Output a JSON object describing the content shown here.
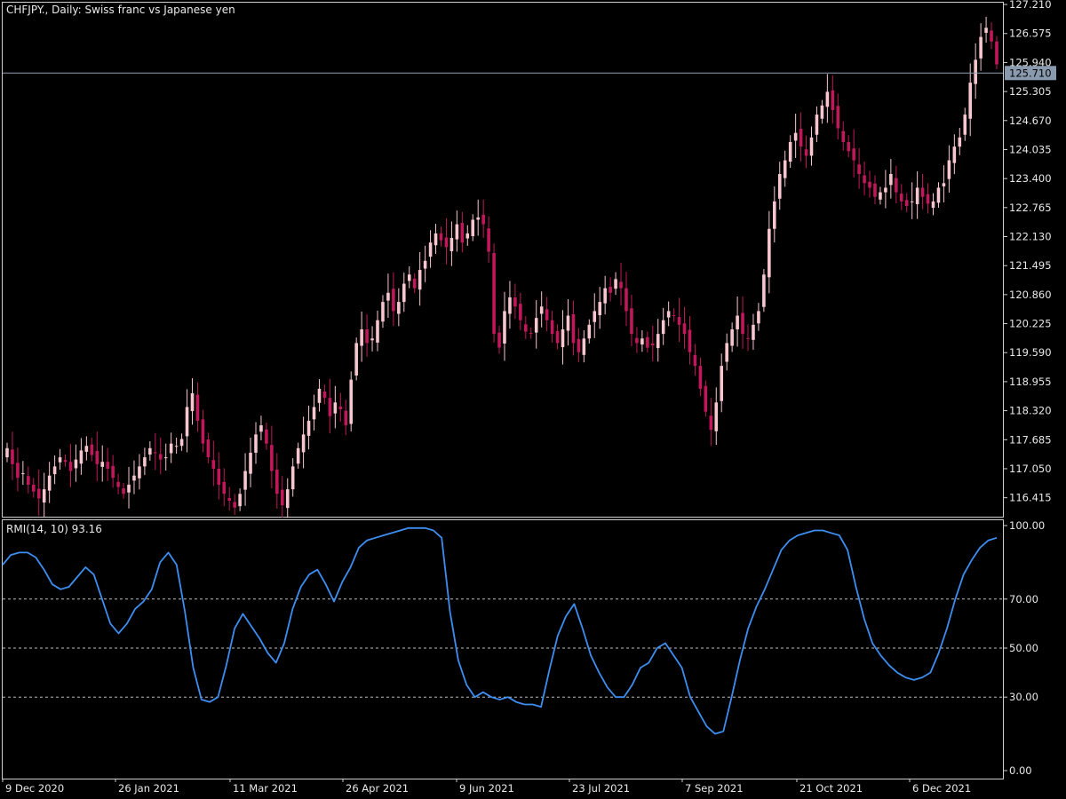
{
  "chart_data": [
    {
      "type": "candlestick",
      "title": "CHFJPY., Daily:  Swiss franc vs Japanese yen",
      "ylim": [
        116.0,
        127.25
      ],
      "y_ticks": [
        "127.210",
        "126.575",
        "125.940",
        "125.305",
        "124.670",
        "124.035",
        "123.400",
        "122.765",
        "122.130",
        "121.495",
        "120.860",
        "120.225",
        "119.590",
        "118.955",
        "118.320",
        "117.685",
        "117.050",
        "116.415"
      ],
      "current_price": "125.710",
      "current_price_value": 125.71,
      "colors": {
        "bull": "#f7c6cf",
        "bear": "#c2185b",
        "price_line": "#8fa0b8"
      },
      "closes": [
        117.5,
        117.15,
        116.85,
        116.95,
        116.7,
        116.55,
        116.4,
        116.6,
        116.9,
        117.1,
        117.3,
        117.2,
        117.0,
        117.25,
        117.45,
        117.55,
        117.35,
        117.15,
        117.2,
        117.05,
        116.85,
        116.65,
        116.5,
        116.7,
        116.9,
        117.1,
        117.3,
        117.5,
        117.4,
        117.25,
        117.3,
        117.6,
        117.55,
        117.7,
        118.4,
        118.7,
        118.1,
        117.6,
        117.3,
        117.05,
        116.7,
        116.5,
        116.35,
        116.2,
        116.5,
        117.0,
        117.4,
        117.8,
        118.0,
        117.6,
        117.0,
        116.5,
        116.25,
        116.6,
        117.1,
        117.5,
        117.8,
        118.1,
        118.4,
        118.8,
        118.6,
        118.2,
        118.5,
        118.35,
        118.0,
        119.0,
        119.8,
        120.1,
        119.8,
        119.9,
        120.3,
        120.7,
        120.9,
        120.5,
        120.7,
        121.1,
        121.3,
        121.0,
        121.4,
        121.6,
        122.0,
        122.2,
        122.05,
        121.9,
        122.1,
        122.4,
        122.0,
        122.2,
        122.5,
        122.55,
        122.4,
        121.8,
        120.0,
        119.7,
        120.5,
        120.8,
        120.6,
        120.3,
        120.05,
        120.0,
        120.35,
        120.6,
        120.3,
        120.0,
        119.8,
        120.1,
        120.4,
        119.8,
        119.6,
        119.9,
        120.2,
        120.5,
        120.7,
        121.0,
        120.9,
        121.2,
        121.0,
        120.5,
        120.0,
        119.8,
        119.9,
        119.7,
        119.75,
        120.0,
        120.3,
        120.5,
        120.4,
        120.2,
        120.0,
        119.6,
        119.3,
        118.8,
        118.3,
        117.9,
        118.5,
        119.3,
        119.8,
        120.1,
        120.4,
        120.0,
        119.9,
        120.2,
        120.5,
        121.3,
        122.3,
        122.9,
        123.5,
        123.8,
        124.2,
        124.4,
        124.1,
        123.9,
        124.3,
        124.8,
        125.0,
        125.3,
        124.9,
        124.5,
        124.2,
        124.0,
        123.8,
        123.5,
        123.3,
        123.2,
        123.0,
        123.1,
        123.2,
        123.5,
        123.1,
        122.9,
        122.8,
        122.9,
        123.2,
        123.0,
        122.85,
        122.9,
        123.2,
        123.3,
        123.8,
        124.1,
        124.3,
        124.8,
        125.5,
        126.0,
        126.5,
        126.7,
        126.4,
        125.9
      ]
    },
    {
      "type": "line",
      "title": "RMI(14, 10) 93.16",
      "ylim": [
        0,
        100
      ],
      "y_ticks": [
        "100.00",
        "70.00",
        "50.00",
        "30.00",
        "0.00"
      ],
      "levels": [
        70,
        50,
        30
      ],
      "series": [
        {
          "color": "#3d8ef0",
          "values": [
            84,
            88,
            89,
            89,
            87,
            82,
            76,
            74,
            75,
            79,
            83,
            80,
            70,
            60,
            56,
            60,
            66,
            69,
            74,
            85,
            89,
            84,
            65,
            42,
            29,
            28,
            30,
            43,
            58,
            64,
            59,
            54,
            48,
            44,
            52,
            66,
            75,
            80,
            82,
            76,
            69,
            77,
            83,
            91,
            94,
            95,
            96,
            97,
            98,
            99,
            99,
            99,
            98,
            95,
            65,
            45,
            35,
            30,
            32,
            30,
            29,
            30,
            28,
            27,
            27,
            26,
            41,
            55,
            63,
            68,
            58,
            47,
            40,
            34,
            30,
            30,
            35,
            42,
            44,
            50,
            52,
            47,
            42,
            30,
            24,
            18,
            15,
            16,
            30,
            45,
            58,
            67,
            74,
            82,
            90,
            94,
            96,
            97,
            98,
            98,
            97,
            96,
            90,
            75,
            62,
            52,
            47,
            43,
            40,
            38,
            37,
            38,
            40,
            48,
            58,
            70,
            80,
            86,
            91,
            94,
            95
          ]
        }
      ]
    }
  ],
  "x_labels": [
    "9 Dec 2020",
    "26 Jan 2021",
    "11 Mar 2021",
    "26 Apr 2021",
    "9 Jun 2021",
    "23 Jul 2021",
    "7 Sep 2021",
    "21 Oct 2021",
    "6 Dec 2021"
  ]
}
